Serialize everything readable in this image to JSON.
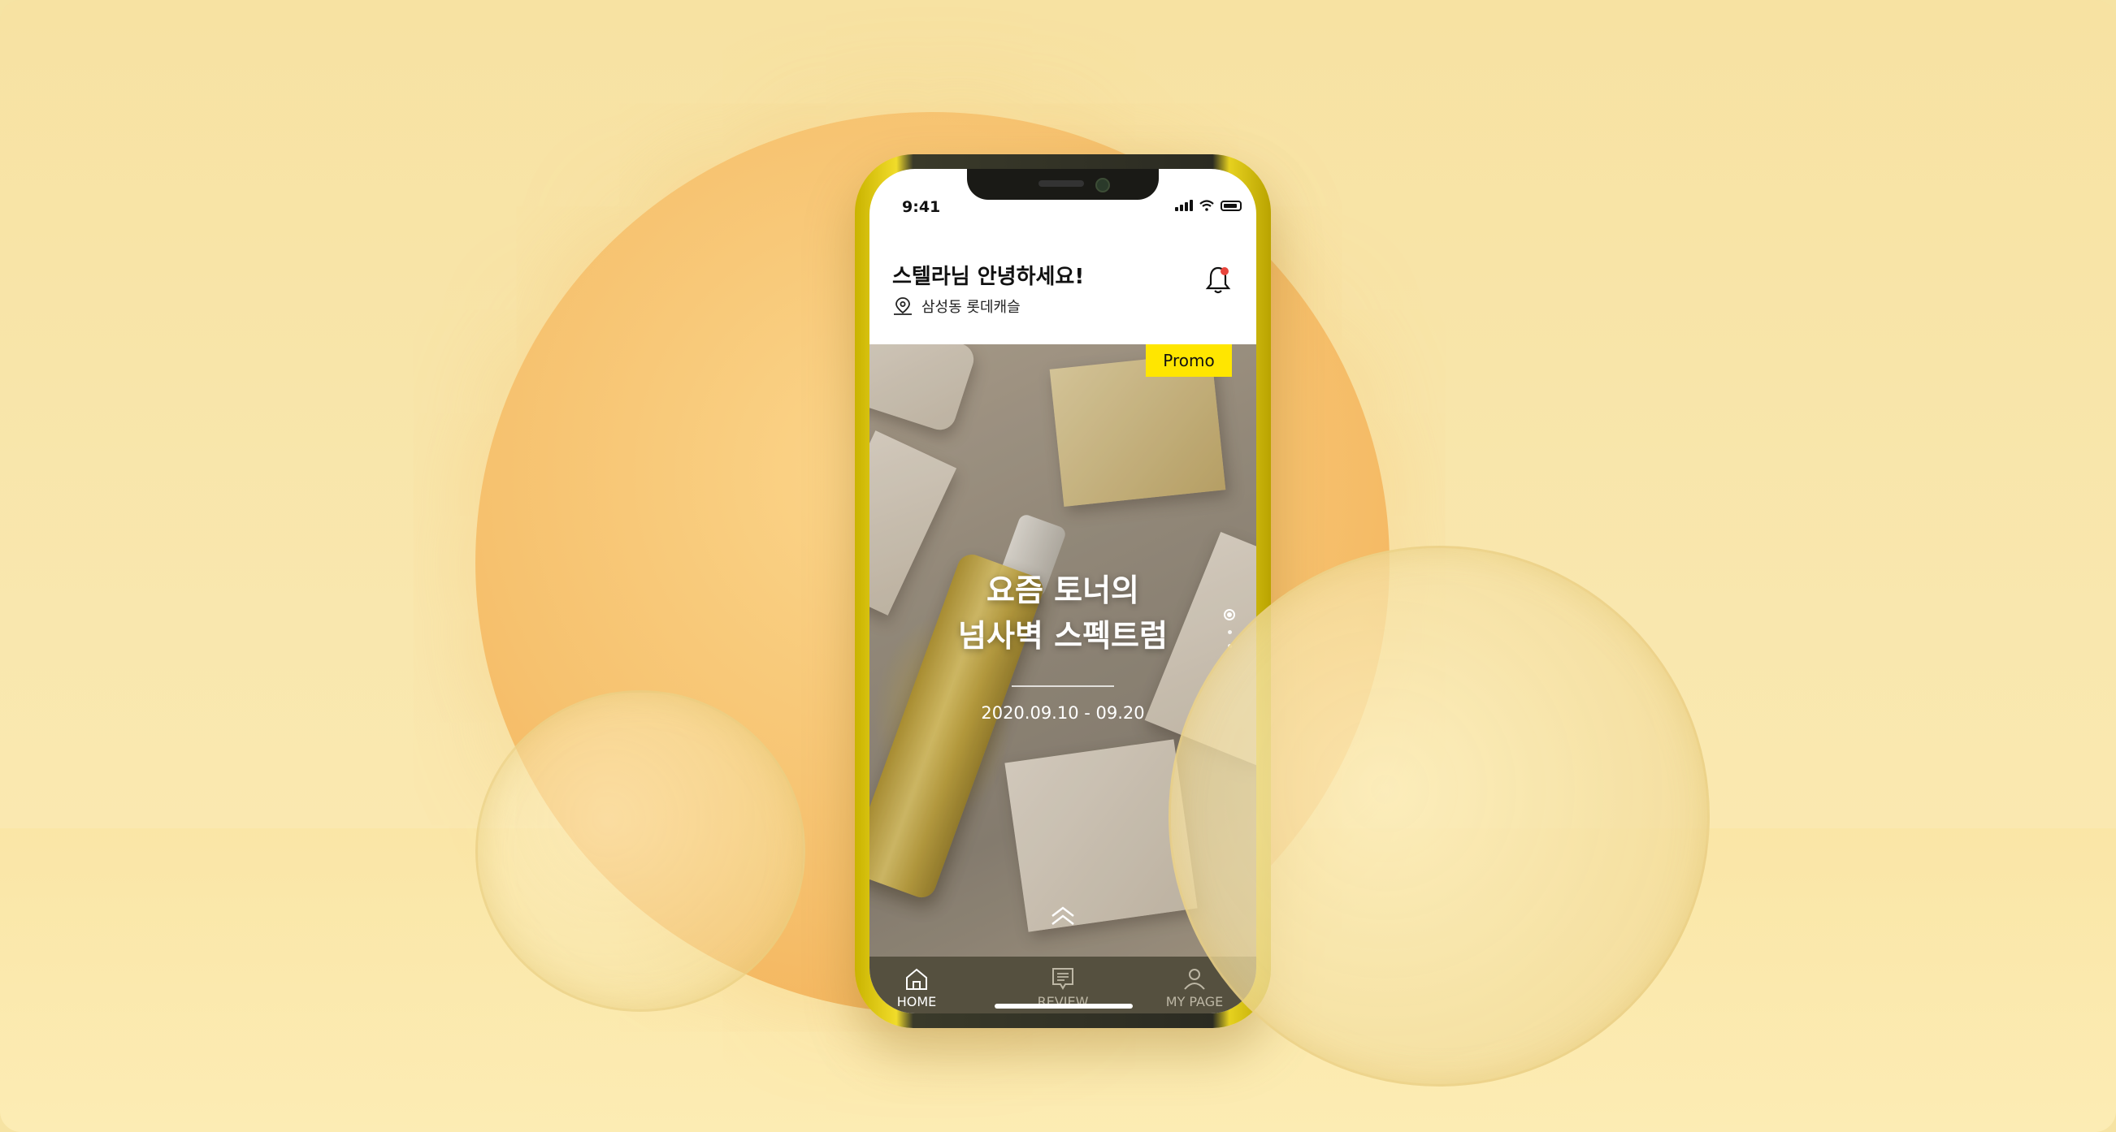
{
  "status_bar": {
    "time": "9:41"
  },
  "header": {
    "greeting": "스텔라님 안녕하세요!",
    "location": "삼성동 롯데캐슬",
    "icons": {
      "location": "map-pin-icon",
      "notification": "bell-icon"
    },
    "notification_dot_color": "#e8453c"
  },
  "hero": {
    "badge": "Promo",
    "title_line1": "요즘 토너의",
    "title_line2": "넘사벽 스펙트럼",
    "date_range": "2020.09.10 - 09.20",
    "pager": {
      "total": 3,
      "active": 1
    }
  },
  "tabbar": {
    "tabs": [
      {
        "label": "HOME",
        "icon": "home-icon",
        "active": true
      },
      {
        "label": "REVIEW",
        "icon": "review-icon",
        "active": false
      },
      {
        "label": "MY PAGE",
        "icon": "user-icon",
        "active": false
      }
    ]
  },
  "colors": {
    "accent_yellow": "#ffe600",
    "background": "#f7e2a2",
    "tabbar": "#55503f"
  }
}
